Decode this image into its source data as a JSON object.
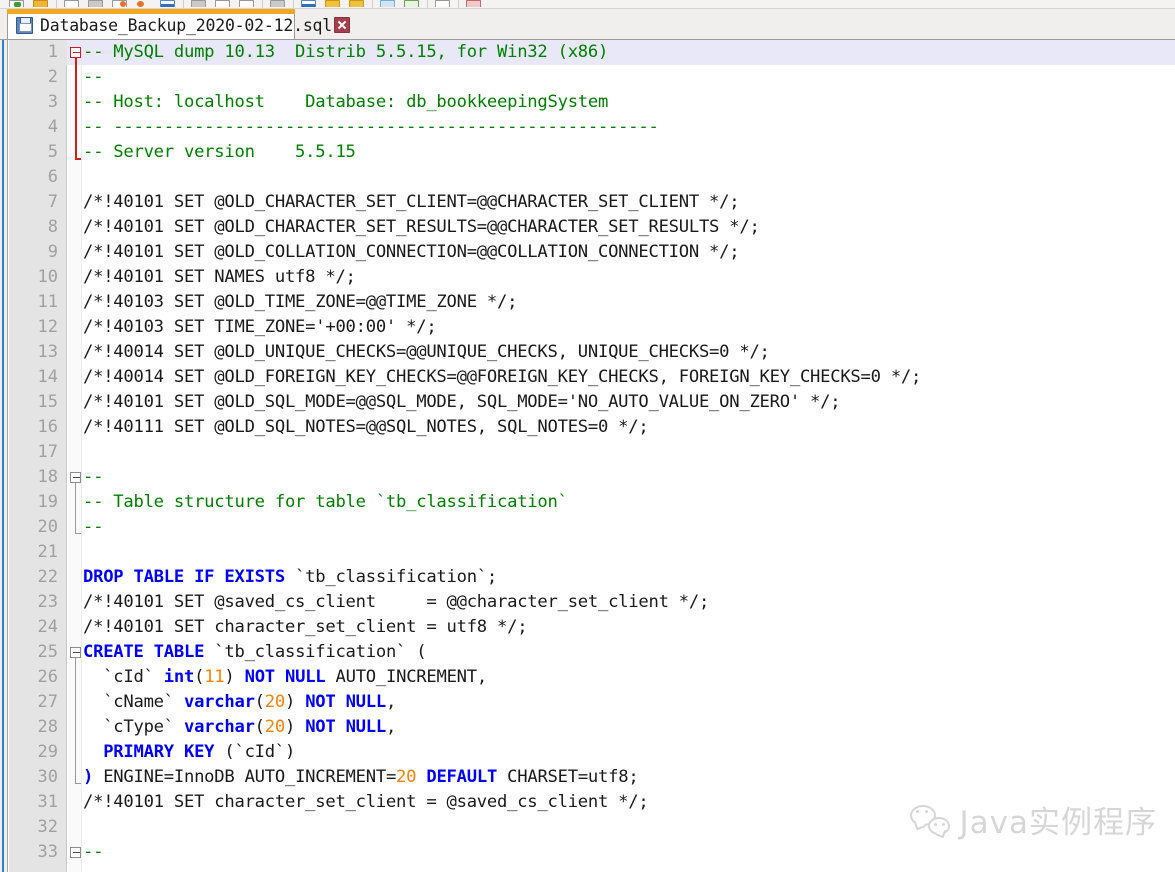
{
  "app": {
    "name": "text-editor",
    "accent_orange": "#f5a524",
    "keyword_color": "#0000ff",
    "comment_color": "#008000",
    "number_color": "#ff8000",
    "text_color": "#1a1a1a",
    "gutter_bg": "#e4e4e4",
    "current_line_bg": "#e8e8f8"
  },
  "toolbar": {
    "buttons": [
      {
        "name": "new-file-button",
        "style": "green"
      },
      {
        "name": "open-folder-button",
        "style": "folder"
      },
      {
        "name": "save-button",
        "style": "plain"
      },
      {
        "name": "save-all-button",
        "style": "gray"
      },
      {
        "name": "close-button",
        "style": "orange"
      },
      {
        "name": "close-all-button",
        "style": "orange2"
      },
      {
        "name": "print-button",
        "style": "blue"
      },
      {
        "name": "cut-button",
        "style": "gray"
      },
      {
        "name": "copy-button",
        "style": "plain"
      },
      {
        "name": "paste-button",
        "style": "plain"
      },
      {
        "name": "undo-button",
        "style": "gray"
      },
      {
        "name": "find-button",
        "style": "blue"
      },
      {
        "name": "zoom-in-button",
        "style": "yellow"
      },
      {
        "name": "zoom-out-button",
        "style": "yellow"
      },
      {
        "name": "word-wrap-button",
        "style": "lightblue"
      },
      {
        "name": "show-symbol-button",
        "style": "green2"
      },
      {
        "name": "macro-record-button",
        "style": "plain"
      },
      {
        "name": "macro-stop-button",
        "style": "red"
      }
    ]
  },
  "tab": {
    "filename": "Database_Backup_2020-02-12.sql",
    "icon": "floppy-disk-save-icon",
    "close_label": "×"
  },
  "watermark": {
    "text": "Java实例程序",
    "logo": "wechat-logo-icon"
  },
  "editor": {
    "current_line": 1,
    "first_visible_line": 1,
    "last_visible_line": 33,
    "folds": [
      {
        "start": 1,
        "end": 5,
        "color": "red"
      },
      {
        "start": 18,
        "end": 20,
        "color": "gray"
      },
      {
        "start": 25,
        "end": 30,
        "color": "gray"
      },
      {
        "start": 33,
        "end": 33,
        "color": "gray"
      }
    ],
    "lines": [
      {
        "n": 1,
        "tokens": [
          {
            "t": "cm",
            "v": "-- MySQL dump 10.13  Distrib 5.5.15, for Win32 (x86)"
          }
        ]
      },
      {
        "n": 2,
        "tokens": [
          {
            "t": "cm",
            "v": "--"
          }
        ]
      },
      {
        "n": 3,
        "tokens": [
          {
            "t": "cm",
            "v": "-- Host: localhost    Database: db_bookkeepingSystem"
          }
        ]
      },
      {
        "n": 4,
        "tokens": [
          {
            "t": "cm",
            "v": "-- ------------------------------------------------------"
          }
        ]
      },
      {
        "n": 5,
        "tokens": [
          {
            "t": "cm",
            "v": "-- Server version\t5.5.15"
          }
        ]
      },
      {
        "n": 6,
        "tokens": []
      },
      {
        "n": 7,
        "tokens": [
          {
            "t": "tx",
            "v": "/*!40101 SET @OLD_CHARACTER_SET_CLIENT=@@CHARACTER_SET_CLIENT */;"
          }
        ]
      },
      {
        "n": 8,
        "tokens": [
          {
            "t": "tx",
            "v": "/*!40101 SET @OLD_CHARACTER_SET_RESULTS=@@CHARACTER_SET_RESULTS */;"
          }
        ]
      },
      {
        "n": 9,
        "tokens": [
          {
            "t": "tx",
            "v": "/*!40101 SET @OLD_COLLATION_CONNECTION=@@COLLATION_CONNECTION */;"
          }
        ]
      },
      {
        "n": 10,
        "tokens": [
          {
            "t": "tx",
            "v": "/*!40101 SET NAMES utf8 */;"
          }
        ]
      },
      {
        "n": 11,
        "tokens": [
          {
            "t": "tx",
            "v": "/*!40103 SET @OLD_TIME_ZONE=@@TIME_ZONE */;"
          }
        ]
      },
      {
        "n": 12,
        "tokens": [
          {
            "t": "tx",
            "v": "/*!40103 SET TIME_ZONE='+00:00' */;"
          }
        ]
      },
      {
        "n": 13,
        "tokens": [
          {
            "t": "tx",
            "v": "/*!40014 SET @OLD_UNIQUE_CHECKS=@@UNIQUE_CHECKS, UNIQUE_CHECKS=0 */;"
          }
        ]
      },
      {
        "n": 14,
        "tokens": [
          {
            "t": "tx",
            "v": "/*!40014 SET @OLD_FOREIGN_KEY_CHECKS=@@FOREIGN_KEY_CHECKS, FOREIGN_KEY_CHECKS=0 */;"
          }
        ]
      },
      {
        "n": 15,
        "tokens": [
          {
            "t": "tx",
            "v": "/*!40101 SET @OLD_SQL_MODE=@@SQL_MODE, SQL_MODE='NO_AUTO_VALUE_ON_ZERO' */;"
          }
        ]
      },
      {
        "n": 16,
        "tokens": [
          {
            "t": "tx",
            "v": "/*!40111 SET @OLD_SQL_NOTES=@@SQL_NOTES, SQL_NOTES=0 */;"
          }
        ]
      },
      {
        "n": 17,
        "tokens": []
      },
      {
        "n": 18,
        "tokens": [
          {
            "t": "cm",
            "v": "--"
          }
        ]
      },
      {
        "n": 19,
        "tokens": [
          {
            "t": "cm",
            "v": "-- Table structure for table `tb_classification`"
          }
        ]
      },
      {
        "n": 20,
        "tokens": [
          {
            "t": "cm",
            "v": "--"
          }
        ]
      },
      {
        "n": 21,
        "tokens": []
      },
      {
        "n": 22,
        "tokens": [
          {
            "t": "kw",
            "v": "DROP TABLE IF EXISTS"
          },
          {
            "t": "tx",
            "v": " `tb_classification`;"
          }
        ]
      },
      {
        "n": 23,
        "tokens": [
          {
            "t": "tx",
            "v": "/*!40101 SET @saved_cs_client     = @@character_set_client */;"
          }
        ]
      },
      {
        "n": 24,
        "tokens": [
          {
            "t": "tx",
            "v": "/*!40101 SET character_set_client = utf8 */;"
          }
        ]
      },
      {
        "n": 25,
        "tokens": [
          {
            "t": "kw",
            "v": "CREATE TABLE"
          },
          {
            "t": "tx",
            "v": " `tb_classification` ("
          }
        ]
      },
      {
        "n": 26,
        "tokens": [
          {
            "t": "tx",
            "v": "  `cId` "
          },
          {
            "t": "kw",
            "v": "int"
          },
          {
            "t": "tx",
            "v": "("
          },
          {
            "t": "num",
            "v": "11"
          },
          {
            "t": "tx",
            "v": ") "
          },
          {
            "t": "kw",
            "v": "NOT NULL"
          },
          {
            "t": "tx",
            "v": " AUTO_INCREMENT,"
          }
        ]
      },
      {
        "n": 27,
        "tokens": [
          {
            "t": "tx",
            "v": "  `cName` "
          },
          {
            "t": "kw",
            "v": "varchar"
          },
          {
            "t": "tx",
            "v": "("
          },
          {
            "t": "num",
            "v": "20"
          },
          {
            "t": "tx",
            "v": ") "
          },
          {
            "t": "kw",
            "v": "NOT NULL"
          },
          {
            "t": "tx",
            "v": ","
          }
        ]
      },
      {
        "n": 28,
        "tokens": [
          {
            "t": "tx",
            "v": "  `cType` "
          },
          {
            "t": "kw",
            "v": "varchar"
          },
          {
            "t": "tx",
            "v": "("
          },
          {
            "t": "num",
            "v": "20"
          },
          {
            "t": "tx",
            "v": ") "
          },
          {
            "t": "kw",
            "v": "NOT NULL"
          },
          {
            "t": "tx",
            "v": ","
          }
        ]
      },
      {
        "n": 29,
        "tokens": [
          {
            "t": "tx",
            "v": "  "
          },
          {
            "t": "kw",
            "v": "PRIMARY KEY"
          },
          {
            "t": "tx",
            "v": " (`cId`)"
          }
        ]
      },
      {
        "n": 30,
        "tokens": [
          {
            "t": "kw",
            "v": ")"
          },
          {
            "t": "tx",
            "v": " ENGINE=InnoDB AUTO_INCREMENT="
          },
          {
            "t": "num",
            "v": "20"
          },
          {
            "t": "tx",
            "v": " "
          },
          {
            "t": "kw",
            "v": "DEFAULT"
          },
          {
            "t": "tx",
            "v": " CHARSET=utf8;"
          }
        ]
      },
      {
        "n": 31,
        "tokens": [
          {
            "t": "tx",
            "v": "/*!40101 SET character_set_client = @saved_cs_client */;"
          }
        ]
      },
      {
        "n": 32,
        "tokens": []
      },
      {
        "n": 33,
        "tokens": [
          {
            "t": "cm",
            "v": "--"
          }
        ]
      }
    ]
  }
}
